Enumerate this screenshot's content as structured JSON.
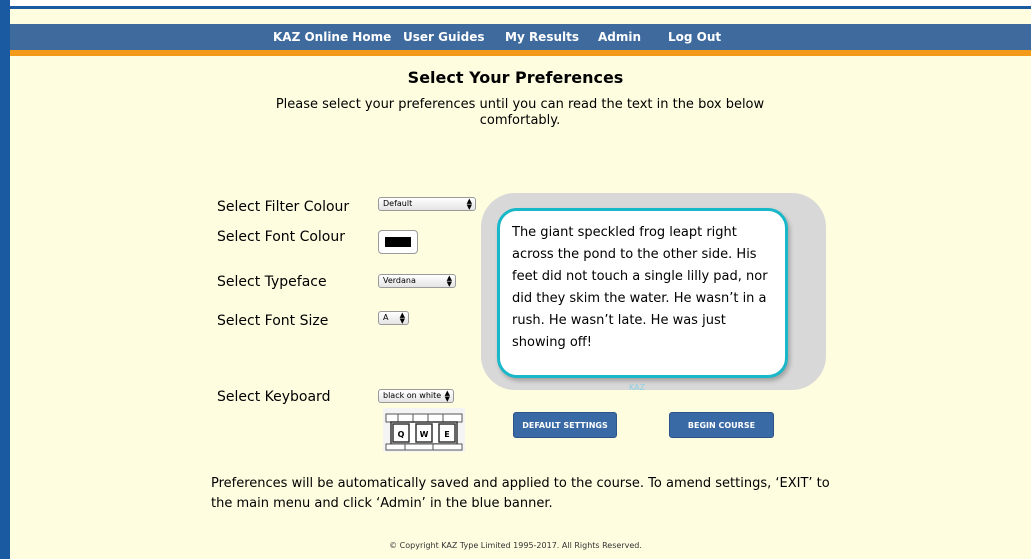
{
  "nav": {
    "items": [
      {
        "label": "KAZ Online Home"
      },
      {
        "label": "User Guides"
      },
      {
        "label": "My Results"
      },
      {
        "label": "Admin"
      },
      {
        "label": "Log Out"
      }
    ]
  },
  "page": {
    "title": "Select Your Preferences",
    "instructions": "Please select your preferences until you can read the text in the box below comfortably."
  },
  "preferences": {
    "filter_colour": {
      "label": "Select Filter Colour",
      "value": "Default"
    },
    "font_colour": {
      "label": "Select Font Colour",
      "value_color": "#000000"
    },
    "typeface": {
      "label": "Select Typeface",
      "value": "Verdana"
    },
    "font_size": {
      "label": "Select Font Size",
      "value": "A"
    },
    "keyboard": {
      "label": "Select Keyboard",
      "value": "black on white",
      "keys": [
        "Q",
        "W",
        "E"
      ]
    }
  },
  "sample": {
    "text": "The giant speckled frog leapt right across the pond to the other side. His feet did not touch a single lilly pad, nor did they skim the water. He wasn’t in a rush. He wasn’t late. He was just showing off!",
    "watermark": "KAZ"
  },
  "buttons": {
    "default_settings": "DEFAULT SETTINGS",
    "begin_course": "BEGIN COURSE"
  },
  "footer": {
    "note": "Preferences will be automatically saved and applied to the course. To amend settings, ‘EXIT’ to the main menu and click ‘Admin’ in the blue banner.",
    "copyright": "© Copyright KAZ Type Limited 1995-2017. All Rights Reserved."
  },
  "colors": {
    "page_background": "#fffde0",
    "nav_background": "#3e6a9d",
    "nav_stripe": "#f39a1b",
    "frame_blue": "#1a5aa1",
    "sample_border": "#18b8c8",
    "button_blue": "#3a6aa5"
  }
}
